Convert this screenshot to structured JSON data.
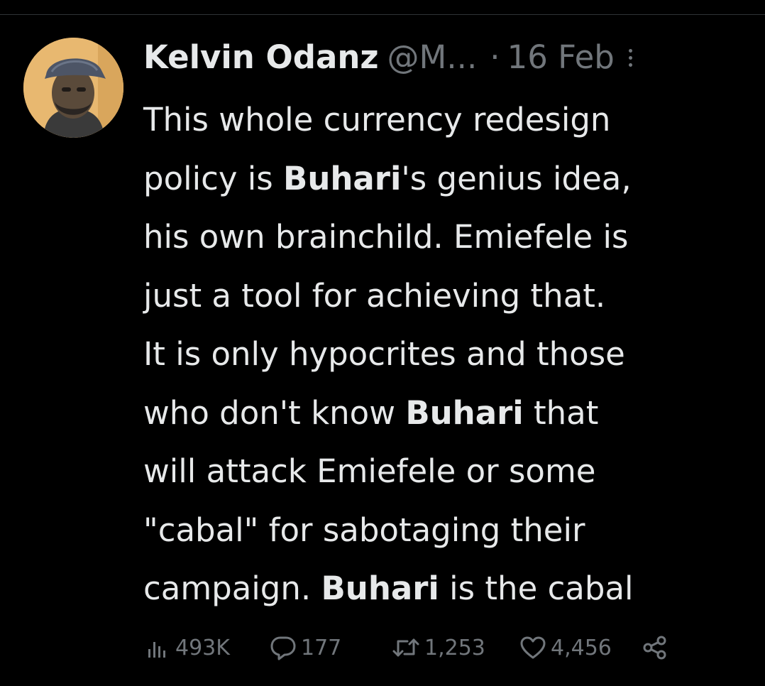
{
  "tweet": {
    "author": {
      "display_name": "Kelvin Odanz",
      "handle": "@M...",
      "avatar_icon": "user-avatar"
    },
    "separator": "·",
    "date": "16 Feb",
    "text_lines": [
      [
        {
          "t": "This whole currency redesign",
          "b": false
        }
      ],
      [
        {
          "t": "policy is ",
          "b": false
        },
        {
          "t": "Buhari",
          "b": true
        },
        {
          "t": "'s genius idea,",
          "b": false
        }
      ],
      [
        {
          "t": "his own brainchild. Emiefele is",
          "b": false
        }
      ],
      [
        {
          "t": "just a tool for achieving that.",
          "b": false
        }
      ],
      [
        {
          "t": "It is only hypocrites and those",
          "b": false
        }
      ],
      [
        {
          "t": "who don't know ",
          "b": false
        },
        {
          "t": "Buhari",
          "b": true
        },
        {
          "t": " that",
          "b": false
        }
      ],
      [
        {
          "t": "will attack Emiefele or some",
          "b": false
        }
      ],
      [
        {
          "t": "\"cabal\" for sabotaging their",
          "b": false
        }
      ],
      [
        {
          "t": "campaign. ",
          "b": false
        },
        {
          "t": "Buhari",
          "b": true
        },
        {
          "t": " is the cabal",
          "b": false
        }
      ]
    ],
    "stats": {
      "views": "493K",
      "replies": "177",
      "retweets": "1,253",
      "likes": "4,456"
    }
  },
  "icons": {
    "views": "bar-chart-icon",
    "replies": "speech-bubble-icon",
    "retweets": "retweet-arrows-icon",
    "likes": "heart-icon",
    "share": "share-nodes-icon",
    "more": "more-dots-vertical-icon"
  },
  "colors": {
    "background": "#000000",
    "text_primary": "#e7e9ea",
    "text_secondary": "#71767b",
    "divider": "#2f3336"
  }
}
